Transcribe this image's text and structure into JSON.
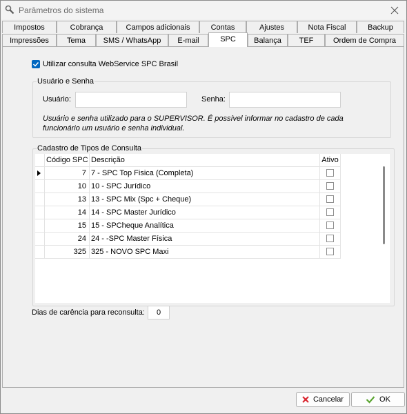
{
  "window": {
    "title": "Parâmetros do sistema"
  },
  "tabs_row1": [
    {
      "label": "Impostos"
    },
    {
      "label": "Cobrança"
    },
    {
      "label": "Campos adicionais"
    },
    {
      "label": "Contas"
    },
    {
      "label": "Ajustes"
    },
    {
      "label": "Nota Fiscal"
    },
    {
      "label": "Backup"
    }
  ],
  "tabs_row2": [
    {
      "label": "Impressões"
    },
    {
      "label": "Tema"
    },
    {
      "label": "SMS / WhatsApp"
    },
    {
      "label": "E-mail"
    },
    {
      "label": "SPC"
    },
    {
      "label": "Balança"
    },
    {
      "label": "TEF"
    },
    {
      "label": "Ordem de Compra"
    }
  ],
  "active_tab": "SPC",
  "spc": {
    "use_webservice_label": "Utilizar consulta WebService SPC Brasil",
    "use_webservice_checked": true,
    "credentials": {
      "legend": "Usuário e Senha",
      "user_label": "Usuário:",
      "user_value": "",
      "password_label": "Senha:",
      "password_value": "",
      "note": "Usuário e senha utilizado para o SUPERVISOR. É possível informar no cadastro de cada funcionário um usuário e senha individual."
    },
    "query_types": {
      "legend": "Cadastro de Tipos de Consulta",
      "columns": {
        "code": "Código SPC",
        "description": "Descrição",
        "active": "Ativo"
      },
      "rows": [
        {
          "code": "7",
          "description": "7 - SPC Top Fisica (Completa)",
          "active": false
        },
        {
          "code": "10",
          "description": "10 - SPC Jurídico",
          "active": false
        },
        {
          "code": "13",
          "description": "13 - SPC Mix (Spc + Cheque)",
          "active": false
        },
        {
          "code": "14",
          "description": "14 - SPC Master Jurídico",
          "active": false
        },
        {
          "code": "15",
          "description": "15 - SPCheque Analítica",
          "active": false
        },
        {
          "code": "24",
          "description": "24 -  -SPC Master Física",
          "active": false
        },
        {
          "code": "325",
          "description": "325 - NOVO SPC Maxi",
          "active": false
        }
      ]
    },
    "grace_days_label": "Dias de carência para reconsulta:",
    "grace_days_value": "0"
  },
  "buttons": {
    "cancel": "Cancelar",
    "ok": "OK"
  },
  "colors": {
    "accent": "#0067c0",
    "cancel_icon": "#d9232d",
    "ok_icon": "#5ba532"
  }
}
